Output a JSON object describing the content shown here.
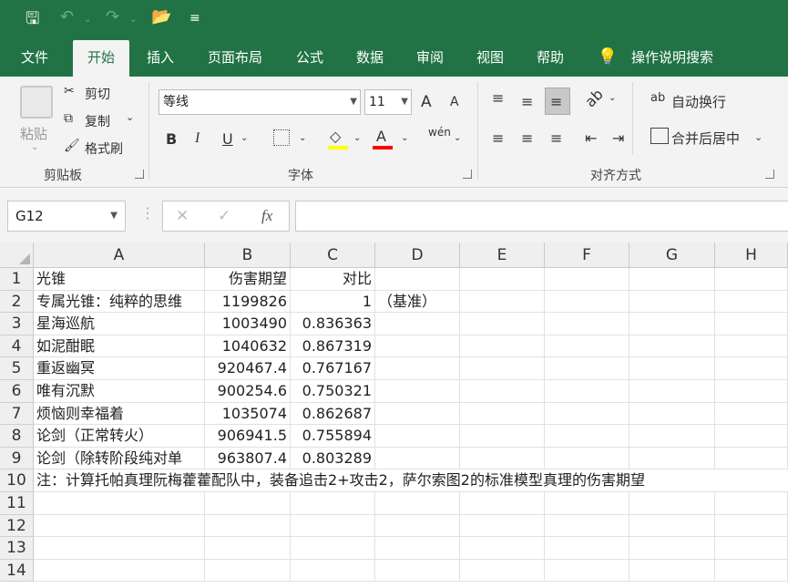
{
  "titlebar": {
    "save": "🖫",
    "undo": "↶",
    "redo": "↷",
    "open": "📂",
    "more": "≡"
  },
  "tabs": [
    "文件",
    "开始",
    "插入",
    "页面布局",
    "公式",
    "数据",
    "审阅",
    "视图",
    "帮助",
    "操作说明搜索"
  ],
  "clipboard": {
    "paste": "粘贴",
    "cut": "剪切",
    "copy": "复制",
    "format_painter": "格式刷",
    "label": "剪贴板"
  },
  "font": {
    "name": "等线",
    "size": "11",
    "label": "字体",
    "bold": "B",
    "italic": "I",
    "underline": "U",
    "phonetic": "wén",
    "grow": "A",
    "shrink": "A",
    "fill": "◇",
    "color": "A"
  },
  "alignment": {
    "wrap": "自动换行",
    "merge": "合并后居中",
    "label": "对齐方式"
  },
  "formula_bar": {
    "name_box": "G12",
    "cancel": "✕",
    "enter": "✓",
    "fx": "fx",
    "formula": ""
  },
  "columns": [
    "A",
    "B",
    "C",
    "D",
    "E",
    "F",
    "G",
    "H"
  ],
  "rows": [
    {
      "n": "1",
      "A": "光锥",
      "B": "伤害期望",
      "C": "对比",
      "D": ""
    },
    {
      "n": "2",
      "A": "专属光锥：纯粹的思维",
      "B": "1199826",
      "C": "1",
      "D": "（基准）"
    },
    {
      "n": "3",
      "A": "星海巡航",
      "B": "1003490",
      "C": "0.836363",
      "D": ""
    },
    {
      "n": "4",
      "A": "如泥酣眠",
      "B": "1040632",
      "C": "0.867319",
      "D": ""
    },
    {
      "n": "5",
      "A": "重返幽冥",
      "B": "920467.4",
      "C": "0.767167",
      "D": ""
    },
    {
      "n": "6",
      "A": "唯有沉默",
      "B": "900254.6",
      "C": "0.750321",
      "D": ""
    },
    {
      "n": "7",
      "A": "烦恼则幸福着",
      "B": "1035074",
      "C": "0.862687",
      "D": ""
    },
    {
      "n": "8",
      "A": "论剑（正常转火）",
      "B": "906941.5",
      "C": "0.755894",
      "D": ""
    },
    {
      "n": "9",
      "A": "论剑（除转阶段纯对单",
      "B": "963807.4",
      "C": "0.803289",
      "D": ""
    },
    {
      "n": "10",
      "A": "注：计算托帕真理阮梅藿藿配队中，装备追击2+攻击2，萨尔索图2的标准模型真理的伤害期望",
      "B": "",
      "C": "",
      "D": ""
    },
    {
      "n": "11",
      "A": "",
      "B": "",
      "C": "",
      "D": ""
    },
    {
      "n": "12",
      "A": "",
      "B": "",
      "C": "",
      "D": ""
    },
    {
      "n": "13",
      "A": "",
      "B": "",
      "C": "",
      "D": ""
    },
    {
      "n": "14",
      "A": "",
      "B": "",
      "C": "",
      "D": ""
    }
  ],
  "colors": {
    "excel_green": "#217346",
    "ribbon_bg": "#f3f3f3"
  }
}
